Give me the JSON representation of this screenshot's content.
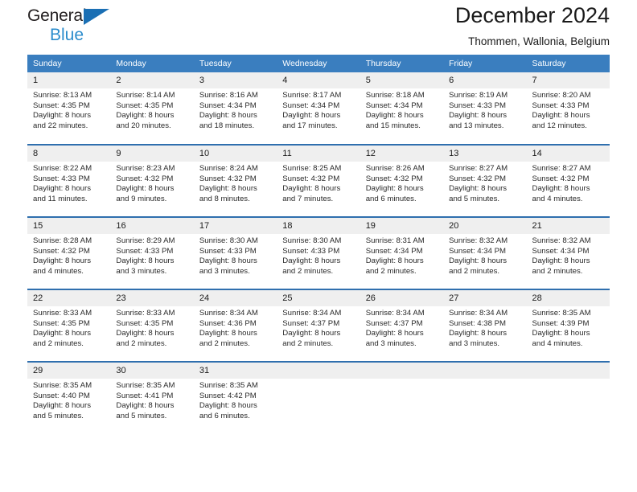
{
  "brand": {
    "name_top": "General",
    "name_bottom": "Blue",
    "triangle_color": "#1a6fb4",
    "blue_text_color": "#2b8ccc"
  },
  "header": {
    "title": "December 2024",
    "subtitle": "Thommen, Wallonia, Belgium"
  },
  "theme": {
    "header_row_bg": "#3a7ebf",
    "row_divider": "#2f6fae",
    "daynum_bg": "#efefef",
    "text": "#1a1a1a"
  },
  "weekdays": [
    "Sunday",
    "Monday",
    "Tuesday",
    "Wednesday",
    "Thursday",
    "Friday",
    "Saturday"
  ],
  "weeks": [
    [
      {
        "day": "1",
        "sunrise": "Sunrise: 8:13 AM",
        "sunset": "Sunset: 4:35 PM",
        "daylight1": "Daylight: 8 hours",
        "daylight2": "and 22 minutes."
      },
      {
        "day": "2",
        "sunrise": "Sunrise: 8:14 AM",
        "sunset": "Sunset: 4:35 PM",
        "daylight1": "Daylight: 8 hours",
        "daylight2": "and 20 minutes."
      },
      {
        "day": "3",
        "sunrise": "Sunrise: 8:16 AM",
        "sunset": "Sunset: 4:34 PM",
        "daylight1": "Daylight: 8 hours",
        "daylight2": "and 18 minutes."
      },
      {
        "day": "4",
        "sunrise": "Sunrise: 8:17 AM",
        "sunset": "Sunset: 4:34 PM",
        "daylight1": "Daylight: 8 hours",
        "daylight2": "and 17 minutes."
      },
      {
        "day": "5",
        "sunrise": "Sunrise: 8:18 AM",
        "sunset": "Sunset: 4:34 PM",
        "daylight1": "Daylight: 8 hours",
        "daylight2": "and 15 minutes."
      },
      {
        "day": "6",
        "sunrise": "Sunrise: 8:19 AM",
        "sunset": "Sunset: 4:33 PM",
        "daylight1": "Daylight: 8 hours",
        "daylight2": "and 13 minutes."
      },
      {
        "day": "7",
        "sunrise": "Sunrise: 8:20 AM",
        "sunset": "Sunset: 4:33 PM",
        "daylight1": "Daylight: 8 hours",
        "daylight2": "and 12 minutes."
      }
    ],
    [
      {
        "day": "8",
        "sunrise": "Sunrise: 8:22 AM",
        "sunset": "Sunset: 4:33 PM",
        "daylight1": "Daylight: 8 hours",
        "daylight2": "and 11 minutes."
      },
      {
        "day": "9",
        "sunrise": "Sunrise: 8:23 AM",
        "sunset": "Sunset: 4:32 PM",
        "daylight1": "Daylight: 8 hours",
        "daylight2": "and 9 minutes."
      },
      {
        "day": "10",
        "sunrise": "Sunrise: 8:24 AM",
        "sunset": "Sunset: 4:32 PM",
        "daylight1": "Daylight: 8 hours",
        "daylight2": "and 8 minutes."
      },
      {
        "day": "11",
        "sunrise": "Sunrise: 8:25 AM",
        "sunset": "Sunset: 4:32 PM",
        "daylight1": "Daylight: 8 hours",
        "daylight2": "and 7 minutes."
      },
      {
        "day": "12",
        "sunrise": "Sunrise: 8:26 AM",
        "sunset": "Sunset: 4:32 PM",
        "daylight1": "Daylight: 8 hours",
        "daylight2": "and 6 minutes."
      },
      {
        "day": "13",
        "sunrise": "Sunrise: 8:27 AM",
        "sunset": "Sunset: 4:32 PM",
        "daylight1": "Daylight: 8 hours",
        "daylight2": "and 5 minutes."
      },
      {
        "day": "14",
        "sunrise": "Sunrise: 8:27 AM",
        "sunset": "Sunset: 4:32 PM",
        "daylight1": "Daylight: 8 hours",
        "daylight2": "and 4 minutes."
      }
    ],
    [
      {
        "day": "15",
        "sunrise": "Sunrise: 8:28 AM",
        "sunset": "Sunset: 4:32 PM",
        "daylight1": "Daylight: 8 hours",
        "daylight2": "and 4 minutes."
      },
      {
        "day": "16",
        "sunrise": "Sunrise: 8:29 AM",
        "sunset": "Sunset: 4:33 PM",
        "daylight1": "Daylight: 8 hours",
        "daylight2": "and 3 minutes."
      },
      {
        "day": "17",
        "sunrise": "Sunrise: 8:30 AM",
        "sunset": "Sunset: 4:33 PM",
        "daylight1": "Daylight: 8 hours",
        "daylight2": "and 3 minutes."
      },
      {
        "day": "18",
        "sunrise": "Sunrise: 8:30 AM",
        "sunset": "Sunset: 4:33 PM",
        "daylight1": "Daylight: 8 hours",
        "daylight2": "and 2 minutes."
      },
      {
        "day": "19",
        "sunrise": "Sunrise: 8:31 AM",
        "sunset": "Sunset: 4:34 PM",
        "daylight1": "Daylight: 8 hours",
        "daylight2": "and 2 minutes."
      },
      {
        "day": "20",
        "sunrise": "Sunrise: 8:32 AM",
        "sunset": "Sunset: 4:34 PM",
        "daylight1": "Daylight: 8 hours",
        "daylight2": "and 2 minutes."
      },
      {
        "day": "21",
        "sunrise": "Sunrise: 8:32 AM",
        "sunset": "Sunset: 4:34 PM",
        "daylight1": "Daylight: 8 hours",
        "daylight2": "and 2 minutes."
      }
    ],
    [
      {
        "day": "22",
        "sunrise": "Sunrise: 8:33 AM",
        "sunset": "Sunset: 4:35 PM",
        "daylight1": "Daylight: 8 hours",
        "daylight2": "and 2 minutes."
      },
      {
        "day": "23",
        "sunrise": "Sunrise: 8:33 AM",
        "sunset": "Sunset: 4:35 PM",
        "daylight1": "Daylight: 8 hours",
        "daylight2": "and 2 minutes."
      },
      {
        "day": "24",
        "sunrise": "Sunrise: 8:34 AM",
        "sunset": "Sunset: 4:36 PM",
        "daylight1": "Daylight: 8 hours",
        "daylight2": "and 2 minutes."
      },
      {
        "day": "25",
        "sunrise": "Sunrise: 8:34 AM",
        "sunset": "Sunset: 4:37 PM",
        "daylight1": "Daylight: 8 hours",
        "daylight2": "and 2 minutes."
      },
      {
        "day": "26",
        "sunrise": "Sunrise: 8:34 AM",
        "sunset": "Sunset: 4:37 PM",
        "daylight1": "Daylight: 8 hours",
        "daylight2": "and 3 minutes."
      },
      {
        "day": "27",
        "sunrise": "Sunrise: 8:34 AM",
        "sunset": "Sunset: 4:38 PM",
        "daylight1": "Daylight: 8 hours",
        "daylight2": "and 3 minutes."
      },
      {
        "day": "28",
        "sunrise": "Sunrise: 8:35 AM",
        "sunset": "Sunset: 4:39 PM",
        "daylight1": "Daylight: 8 hours",
        "daylight2": "and 4 minutes."
      }
    ],
    [
      {
        "day": "29",
        "sunrise": "Sunrise: 8:35 AM",
        "sunset": "Sunset: 4:40 PM",
        "daylight1": "Daylight: 8 hours",
        "daylight2": "and 5 minutes."
      },
      {
        "day": "30",
        "sunrise": "Sunrise: 8:35 AM",
        "sunset": "Sunset: 4:41 PM",
        "daylight1": "Daylight: 8 hours",
        "daylight2": "and 5 minutes."
      },
      {
        "day": "31",
        "sunrise": "Sunrise: 8:35 AM",
        "sunset": "Sunset: 4:42 PM",
        "daylight1": "Daylight: 8 hours",
        "daylight2": "and 6 minutes."
      },
      {
        "day": "",
        "sunrise": "",
        "sunset": "",
        "daylight1": "",
        "daylight2": ""
      },
      {
        "day": "",
        "sunrise": "",
        "sunset": "",
        "daylight1": "",
        "daylight2": ""
      },
      {
        "day": "",
        "sunrise": "",
        "sunset": "",
        "daylight1": "",
        "daylight2": ""
      },
      {
        "day": "",
        "sunrise": "",
        "sunset": "",
        "daylight1": "",
        "daylight2": ""
      }
    ]
  ]
}
